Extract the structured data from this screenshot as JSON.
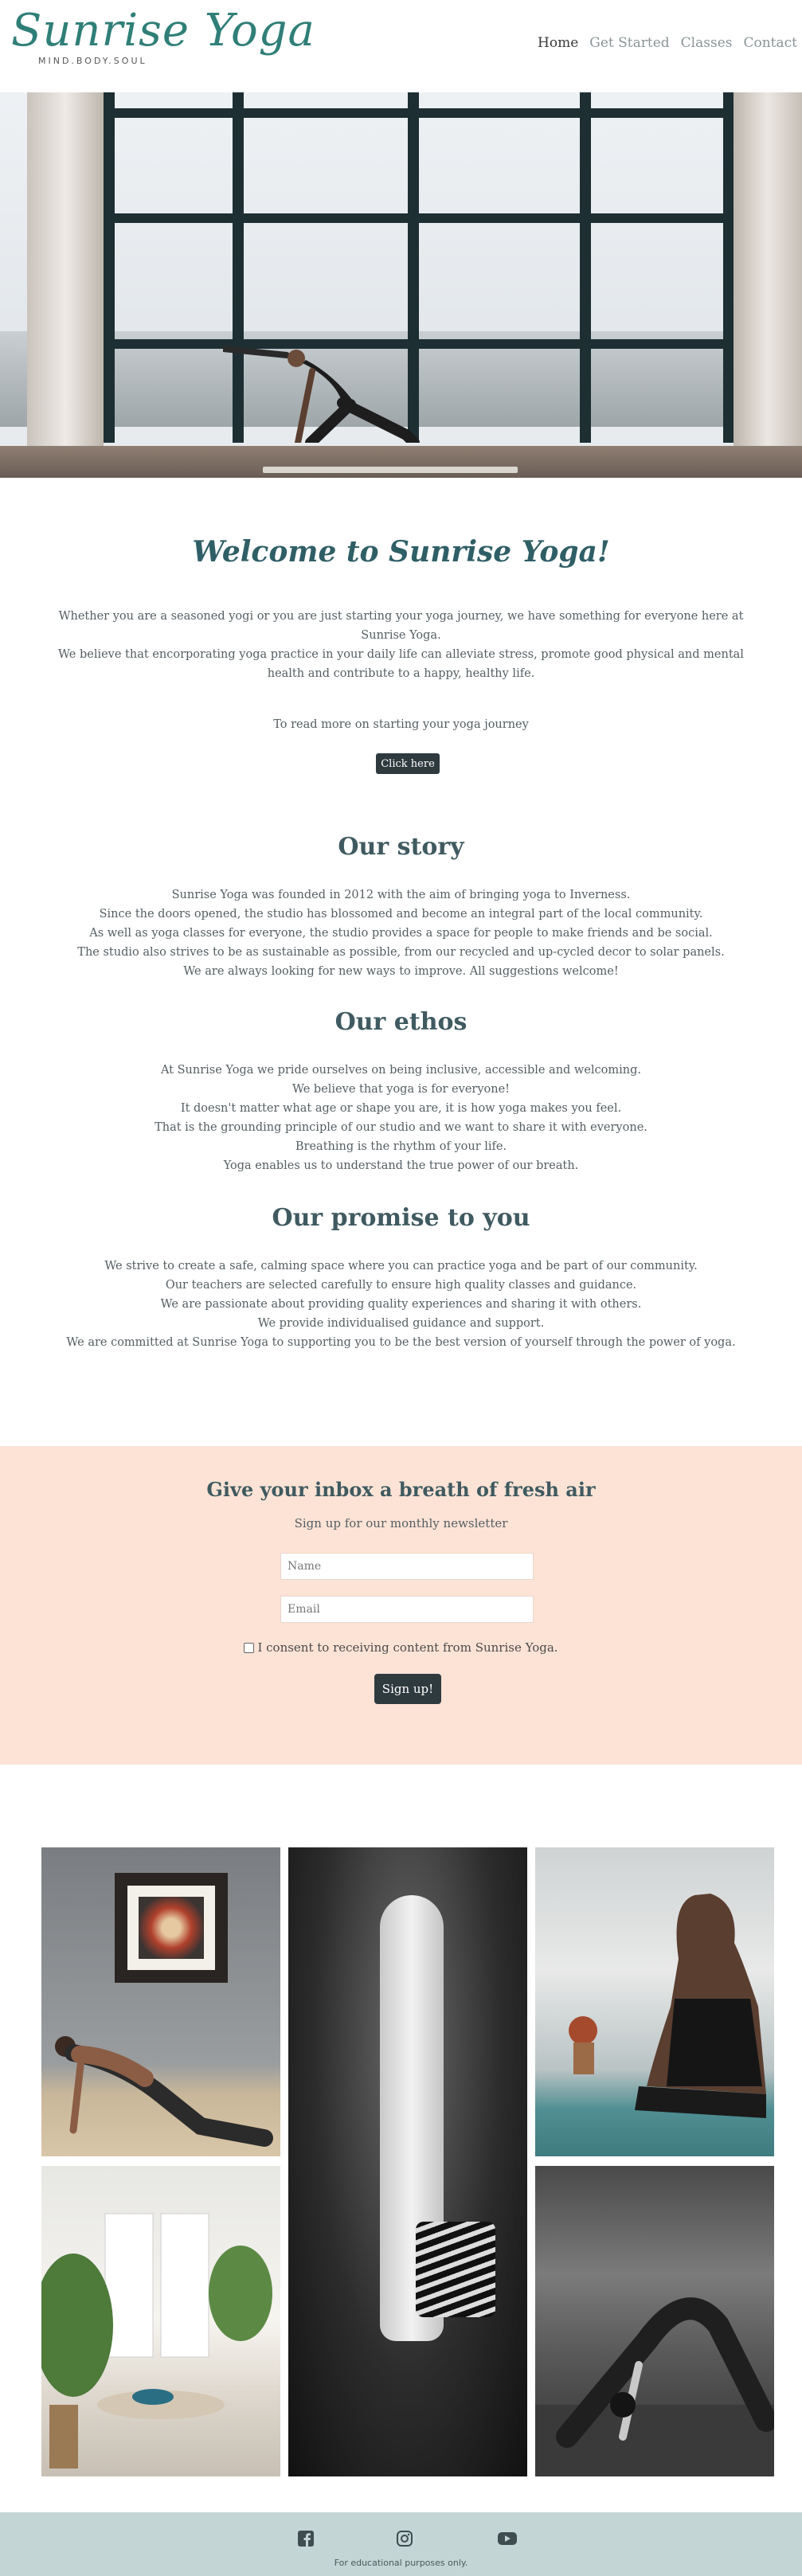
{
  "brand": {
    "logo_text": "Sunrise Yoga",
    "tagline": "MIND.BODY.SOUL",
    "accent": "#2f7f78"
  },
  "nav": {
    "items": [
      {
        "label": "Home"
      },
      {
        "label": "Get Started"
      },
      {
        "label": "Classes"
      },
      {
        "label": "Contact"
      }
    ]
  },
  "welcome": {
    "title": "Welcome to Sunrise Yoga!",
    "line1": "Whether you are a seasoned yogi or you are just starting your yoga journey, we have something for everyone here at Sunrise Yoga.",
    "line2": "We believe that encorporating yoga practice in your daily life can alleviate stress, promote good physical and mental health and contribute to a happy, healthy life.",
    "cta_text": "To read more on starting your yoga journey",
    "cta_button": "Click here"
  },
  "story": {
    "title": "Our story",
    "lines": [
      "Sunrise Yoga was founded in 2012 with the aim of bringing yoga to Inverness.",
      "Since the doors opened, the studio has blossomed and become an integral part of the local community.",
      "As well as yoga classes for everyone, the studio provides a space for people to make friends and be social.",
      "The studio also strives to be as sustainable as possible, from our recycled and up-cycled decor to solar panels.",
      "We are always looking for new ways to improve. All suggestions welcome!"
    ]
  },
  "ethos": {
    "title": "Our ethos",
    "lines": [
      "At Sunrise Yoga we pride ourselves on being inclusive, accessible and welcoming.",
      "We believe that yoga is for everyone!",
      "It doesn't matter what age or shape you are, it is how yoga makes you feel.",
      "That is the grounding principle of our studio and we want to share it with everyone.",
      "Breathing is the rhythm of your life.",
      "Yoga enables us to understand the true power of our breath."
    ]
  },
  "promise": {
    "title": "Our promise to you",
    "lines": [
      "We strive to create a safe, calming space where you can practice yoga and be part of our community.",
      "Our teachers are selected carefully to ensure high quality classes and guidance.",
      "We are passionate about providing quality experiences and sharing it with others.",
      "We provide individualised guidance and support.",
      "We are committed at Sunrise Yoga to supporting you to be the best version of yourself through the power of yoga."
    ]
  },
  "newsletter": {
    "title": "Give your inbox a breath of fresh air",
    "subtitle": "Sign up for our monthly newsletter",
    "name_placeholder": "Name",
    "email_placeholder": "Email",
    "consent_label": "I consent to receiving content from Sunrise Yoga.",
    "submit_label": "Sign up!",
    "background": "#fde3d6"
  },
  "footer": {
    "icons": [
      "facebook-icon",
      "instagram-icon",
      "youtube-icon"
    ],
    "note": "For educational purposes only.",
    "background": "#c3d5d4"
  }
}
